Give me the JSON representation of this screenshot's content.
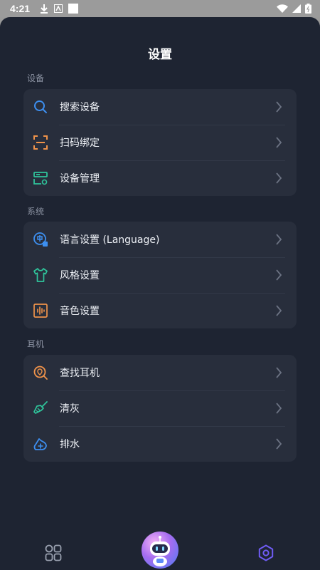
{
  "status_bar": {
    "time": "4:21"
  },
  "page": {
    "title": "设置"
  },
  "sections": [
    {
      "label": "设备",
      "items": [
        {
          "label": "搜索设备",
          "icon": "search-icon",
          "color": "#3d8ff0"
        },
        {
          "label": "扫码绑定",
          "icon": "scan-icon",
          "color": "#f0934a"
        },
        {
          "label": "设备管理",
          "icon": "device-manage-icon",
          "color": "#2fc49b"
        }
      ]
    },
    {
      "label": "系统",
      "items": [
        {
          "label": "语言设置 (Language)",
          "icon": "language-icon",
          "color": "#3d8ff0"
        },
        {
          "label": "风格设置",
          "icon": "shirt-icon",
          "color": "#2fc49b"
        },
        {
          "label": "音色设置",
          "icon": "soundwave-icon",
          "color": "#f0934a"
        }
      ]
    },
    {
      "label": "耳机",
      "items": [
        {
          "label": "查找耳机",
          "icon": "location-search-icon",
          "color": "#f0934a"
        },
        {
          "label": "清灰",
          "icon": "broom-icon",
          "color": "#2fc49b"
        },
        {
          "label": "排水",
          "icon": "drain-icon",
          "color": "#3d8ff0"
        }
      ]
    }
  ],
  "bottom_nav": {
    "items": [
      {
        "icon": "grid-icon"
      },
      {
        "icon": "robot-avatar-icon"
      },
      {
        "icon": "settings-hexagon-icon",
        "active_color": "#6f5cf5"
      }
    ]
  }
}
